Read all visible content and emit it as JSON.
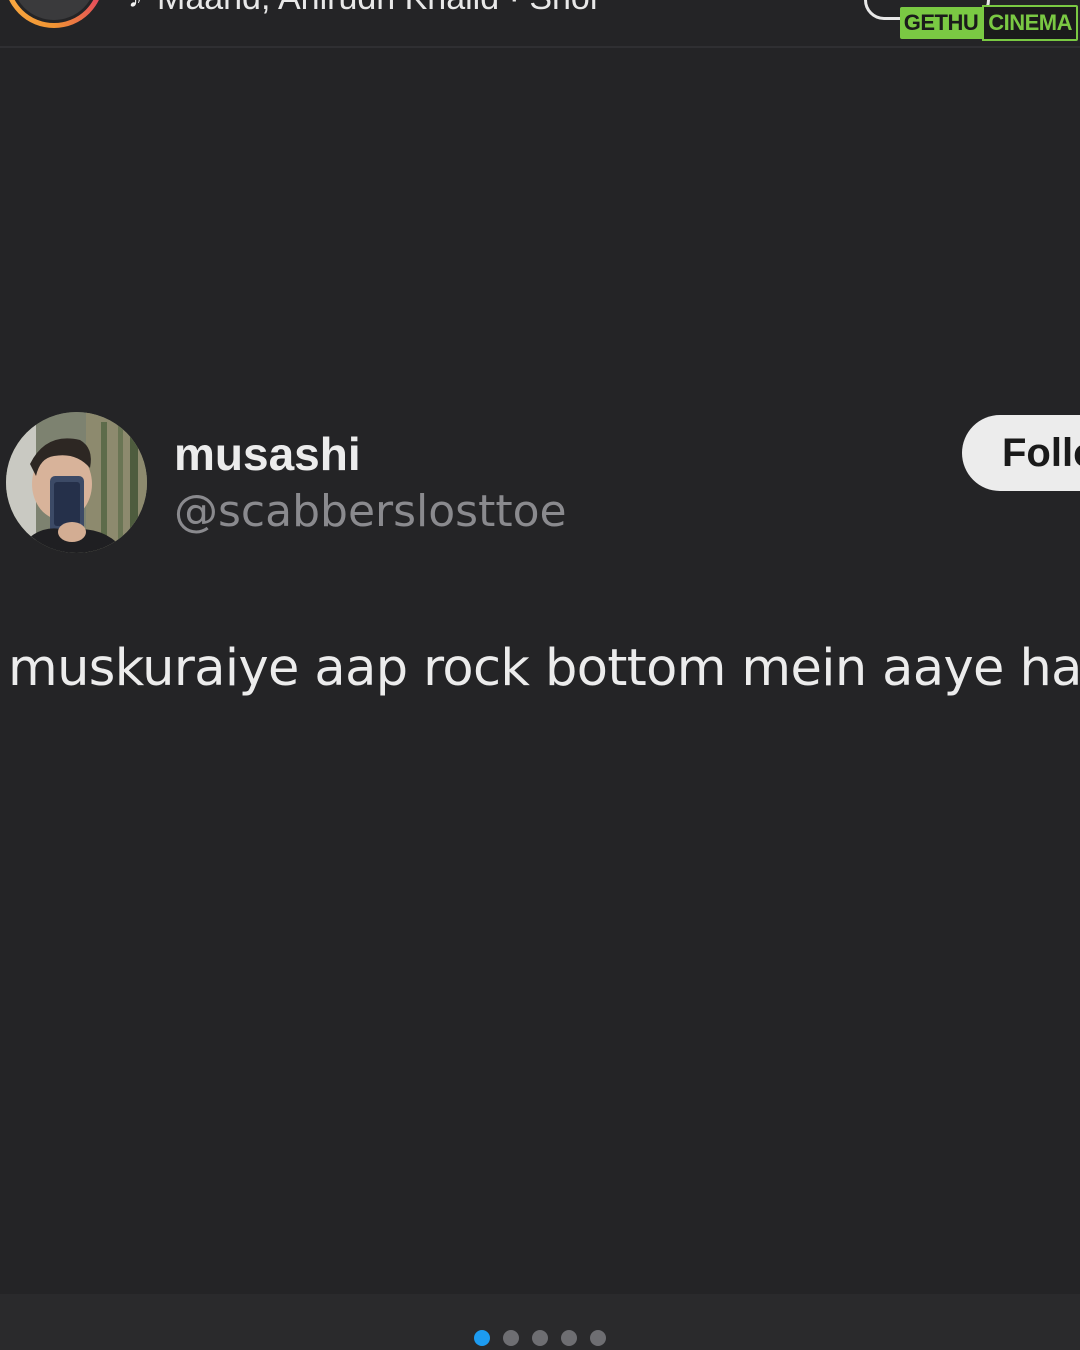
{
  "top_bar": {
    "music_text": "Maand, Anirudh Khalid · Shor",
    "music_icon": "music-note-icon"
  },
  "watermark": {
    "part_a": "GETHU",
    "part_b": "CINEMA",
    "accent": "#7ac943"
  },
  "tweet": {
    "display_name": "musashi",
    "handle": "@scabberslosttoe",
    "follow_label": "Follow",
    "text": "muskuraiye aap rock bottom mein aaye hain"
  },
  "carousel": {
    "total_dots": 5,
    "active_index": 0,
    "active_color": "#1d9bf0"
  }
}
